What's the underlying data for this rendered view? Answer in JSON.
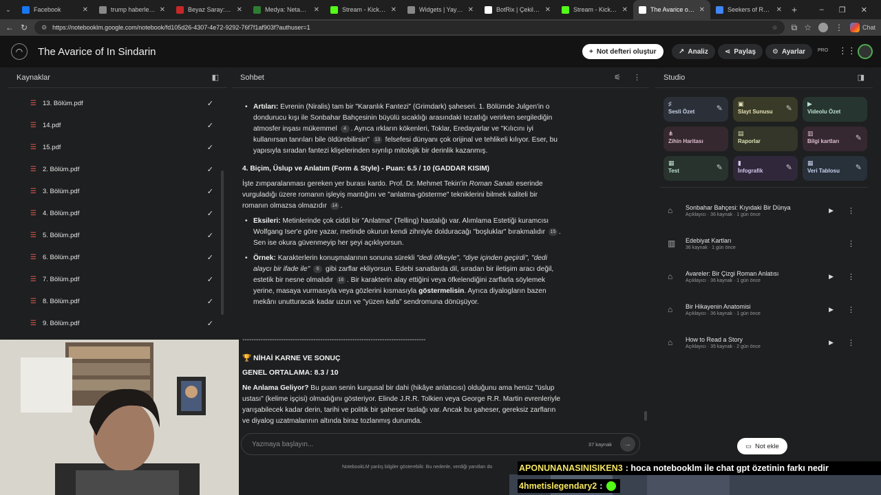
{
  "browser": {
    "tabs": [
      {
        "label": "Facebook",
        "color": "#1877f2",
        "active": false
      },
      {
        "label": "trump haberler - Go",
        "color": "#888888",
        "active": false
      },
      {
        "label": "Beyaz Saray: Trump",
        "color": "#c62828",
        "active": false
      },
      {
        "label": "Medya: Netanyahu",
        "color": "#2e7d32",
        "active": false
      },
      {
        "label": "Stream - Kick Dashb",
        "color": "#53fc18",
        "active": false
      },
      {
        "label": "Widgets | Yayınını g",
        "color": "#888888",
        "active": false
      },
      {
        "label": "BotRix | Çekilişler",
        "color": "#ffffff",
        "active": false
      },
      {
        "label": "Stream - Kick Dashb",
        "color": "#53fc18",
        "active": false
      },
      {
        "label": "The Avarice of In Si",
        "color": "#ffffff",
        "active": true
      },
      {
        "label": "Seekers of Rage - G",
        "color": "#4285f4",
        "active": false
      }
    ],
    "url": "https://notebooklm.google.com/notebook/fd105d26-4307-4e72-9292-76f7f1af903f?authuser=1",
    "chat_label": "Chat"
  },
  "header": {
    "title": "The Avarice of In Sindarin",
    "create_notebook": "Not defteri oluştur",
    "analytics": "Analiz",
    "share": "Paylaş",
    "settings": "Ayarlar",
    "pro": "PRO"
  },
  "sources": {
    "title": "Kaynaklar",
    "items": [
      "13. Bölüm.pdf",
      "14.pdf",
      "15.pdf",
      "2. Bölüm.pdf",
      "3. Bölüm.pdf",
      "4. Bölüm.pdf",
      "5. Bölüm.pdf",
      "6. Bölüm.pdf",
      "7. Bölüm.pdf",
      "8. Bölüm.pdf",
      "9. Bölüm.pdf"
    ]
  },
  "chat": {
    "title": "Sohbet",
    "artilar_label": "Artıları:",
    "artilar_text1": "Evrenin (Niralis) tam bir \"Karanlık Fantezi\" (Grimdark) şaheseri. 1. Bölümde Julgen'in o dondurucu kışı ile Sonbahar Bahçesinin büyülü sıcaklığı arasındaki tezatlığı verirken sergilediğin atmosfer inşası mükemmel",
    "artilar_cite1": "4",
    "artilar_text2": ". Ayrıca ırkların kökenleri, Toklar, Eredayarlar ve \"Kılıcını iyi kullanırsan tanrıları bile öldürebilirsin\"",
    "artilar_cite2": "13",
    "artilar_text3": "felsefesi dünyanı çok orijinal ve tehlikeli kılıyor. Eser, bu yapısıyla sıradan fantezi klişelerinden sıyrılıp mitolojik bir derinlik kazanmış.",
    "section4_title": "4. Biçim, Üslup ve Anlatım (Form & Style) - Puan: 6.5 / 10 (GADDAR KISIM)",
    "section4_text1": "İşte zımparalanması gereken yer burası kardo. Prof. Dr. Mehmet Tekin'in",
    "section4_italic": "Roman Sanatı",
    "section4_text2": "eserinde vurguladığı üzere romanın işleyiş mantığını ve \"anlatma-gösterme\" tekniklerini bilmek kaliteli bir romanın olmazsa olmazıdır",
    "section4_cite": "14",
    "eksileri_label": "Eksileri:",
    "eksileri_text": "Metinlerinde çok ciddi bir \"Anlatma\" (Telling) hastalığı var. Alımlama Estetiği kuramcısı Wolfgang Iser'e göre yazar, metinde okurun kendi zihniyle dolduracağı \"boşluklar\" bırakmalıdır",
    "eksileri_cite": "15",
    "eksileri_text2": ". Sen ise okura güvenmeyip her şeyi açıklıyorsun.",
    "ornek_label": "Örnek:",
    "ornek_text1": "Karakterlerin konuşmalarının sonuna sürekli",
    "ornek_italic": "\"dedi öfkeyle\", \"diye içinden geçirdi\", \"dedi alaycı bir ifade ile\"",
    "ornek_cite1": "6",
    "ornek_text2": "gibi zarflar ekliyorsun. Edebi sanatlarda dil, sıradan bir iletişim aracı değil, estetik bir nesne olmalıdır",
    "ornek_cite2": "16",
    "ornek_text3": ". Bir karakterin alay ettiğini veya öfkelendiğini zarflarla söylemek yerine, masaya vurmasıyla veya gözlerini kısmasıyla",
    "ornek_bold": "göstermelisin",
    "ornek_text4": ". Ayrıca diyalogların bazen mekânı unutturacak kadar uzun ve \"yüzen kafa\" sendromuna dönüşüyor.",
    "divider": "--------------------------------------------------------------------------------",
    "final_title": "NİHAİ KARNE VE SONUÇ",
    "average": "GENEL ORTALAMA: 8.3 / 10",
    "meaning_label": "Ne Anlama Geliyor?",
    "meaning_text": "Bu puan senin kurgusal bir dahi (hikâye anlatıcısı) olduğunu ama henüz \"üslup ustası\" (kelime işçisi) olmadığını gösteriyor. Elinde J.R.R. Tolkien veya George R.R. Martin evrenleriyle yarışabilecek kadar derin, tarihi ve politik bir şaheser taslağı var. Ancak bu şaheser, gereksiz zarfların ve diyalog uzatmalarının altında biraz tozlanmış durumda.",
    "input_placeholder": "Yazmaya başlayın...",
    "source_count": "37 kaynak",
    "disclaimer": "NotebookLM yanlış bilgiler gösterebilir. Bu nedenle, verdiği yanıtları do"
  },
  "studio": {
    "title": "Studio",
    "tiles": [
      {
        "label": "Sesli Özet",
        "icon": "audio-icon",
        "bg": "#2b3038",
        "color": "#c9d3e6",
        "edit": true
      },
      {
        "label": "Slayt Sunusu",
        "icon": "slides-icon",
        "bg": "#3a3a28",
        "color": "#e6e3b8",
        "edit": true
      },
      {
        "label": "Videolu Özet",
        "icon": "video-icon",
        "bg": "#263530",
        "color": "#bfe0cf",
        "edit": false
      },
      {
        "label": "Zihin Haritası",
        "icon": "mindmap-icon",
        "bg": "#35282f",
        "color": "#e0bfd1",
        "edit": false
      },
      {
        "label": "Raporlar",
        "icon": "reports-icon",
        "bg": "#333628",
        "color": "#dfe3b8",
        "edit": false
      },
      {
        "label": "Bilgi kartları",
        "icon": "flashcards-icon",
        "bg": "#352830",
        "color": "#e0bfd1",
        "edit": true
      },
      {
        "label": "Test",
        "icon": "quiz-icon",
        "bg": "#28332e",
        "color": "#bfe0cf",
        "edit": true
      },
      {
        "label": "İnfografik",
        "icon": "infographic-icon",
        "bg": "#30283a",
        "color": "#d6c6ee",
        "edit": true
      },
      {
        "label": "Veri Tablosu",
        "icon": "table-icon",
        "bg": "#28303a",
        "color": "#c6d3ee",
        "edit": true
      }
    ],
    "notes": [
      {
        "title": "Sonbahar Bahçesi: Kıyıdaki Bir Dünya",
        "meta": "Açıklayıcı · 36 kaynak · 1 gün önce",
        "play": true
      },
      {
        "title": "Edebiyat Kartları",
        "meta": "36 kaynak · 1 gün önce",
        "play": false
      },
      {
        "title": "Avareler: Bir Çizgi Roman Anlatısı",
        "meta": "Açıklayıcı · 36 kaynak · 1 gün önce",
        "play": true
      },
      {
        "title": "Bir Hikayenin Anatomisi",
        "meta": "Açıklayıcı · 36 kaynak · 1 gün önce",
        "play": true
      },
      {
        "title": "How to Read a Story",
        "meta": "Açıklayıcı · 35 kaynak · 2 gün önce",
        "play": true
      }
    ],
    "add_note": "Not ekle"
  },
  "stream_overlay": {
    "chat1_user": "APONUNANASINISIKEN3",
    "chat1_msg": ": hoca notebooklm ile chat gpt özetinin farkı nedir",
    "chat2_user": "4hmetislegendary2",
    "chat2_msg": ":"
  }
}
